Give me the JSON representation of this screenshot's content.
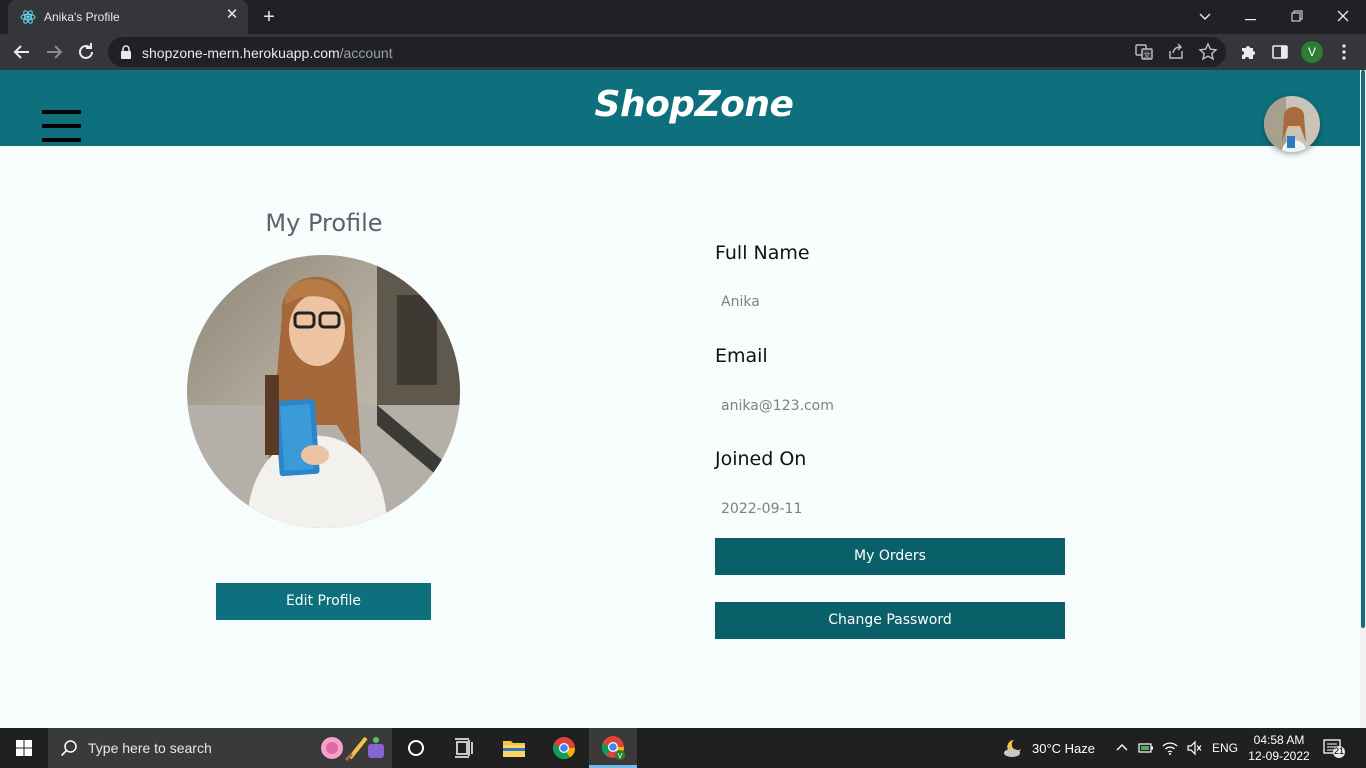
{
  "browser": {
    "tab_title": "Anika's Profile",
    "url_host": "shopzone-mern.herokuapp.com",
    "url_path": "/account",
    "profile_initial": "V"
  },
  "app": {
    "brand": "ShopZone"
  },
  "profile": {
    "heading": "My Profile",
    "edit_label": "Edit Profile",
    "full_name_label": "Full Name",
    "full_name_value": "Anika",
    "email_label": "Email",
    "email_value": "anika@123.com",
    "joined_label": "Joined On",
    "joined_value": "2022-09-11",
    "orders_label": "My Orders",
    "change_password_label": "Change Password"
  },
  "taskbar": {
    "search_placeholder": "Type here to search",
    "weather": "30°C  Haze",
    "language": "ENG",
    "time": "04:58 AM",
    "date": "12-09-2022",
    "notification_count": "21"
  },
  "colors": {
    "accent": "#0e707c",
    "button_dark": "#0a6068"
  }
}
